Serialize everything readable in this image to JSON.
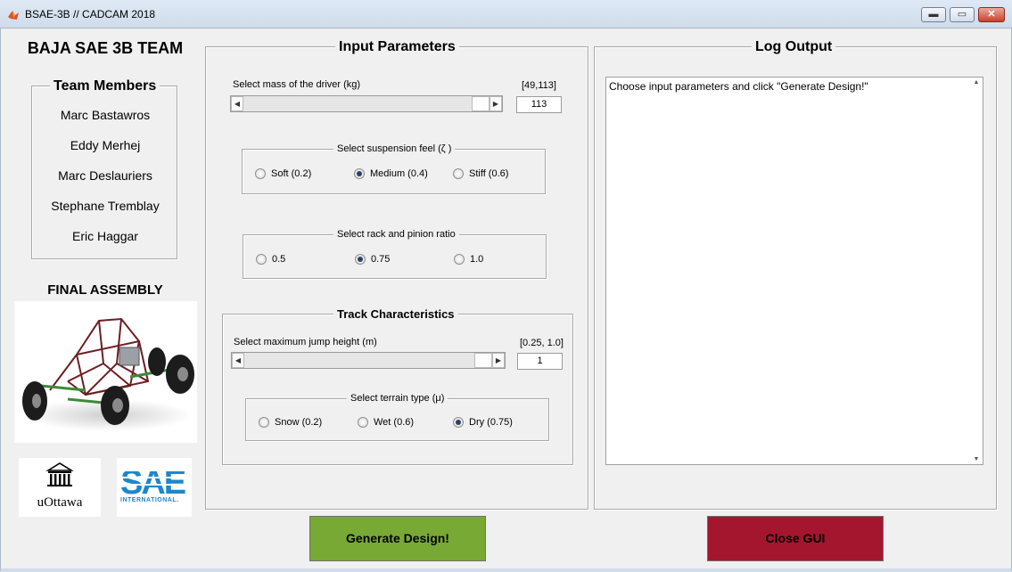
{
  "window": {
    "title": "BSAE-3B // CADCAM 2018",
    "app_icon": "matlab-icon",
    "controls": {
      "minimize": "▬",
      "maximize": "▭",
      "close": "✕"
    }
  },
  "sidebar": {
    "team_title": "BAJA SAE 3B TEAM",
    "members_title": "Team Members",
    "members": [
      "Marc Bastawros",
      "Eddy Merhej",
      "Marc Deslauriers",
      "Stephane Tremblay",
      "Eric Haggar"
    ],
    "assembly_title": "FINAL ASSEMBLY",
    "logos": {
      "uottawa_text": "uOttawa",
      "sae_text": "SAE",
      "sae_subtext": "INTERNATIONAL."
    }
  },
  "input_panel": {
    "title": "Input Parameters",
    "driver_mass": {
      "label": "Select mass of the driver (kg)",
      "range_label": "[49,113]",
      "value": "113",
      "fraction": 1.0
    },
    "suspension": {
      "title": "Select suspension feel (ζ )",
      "options": [
        "Soft (0.2)",
        "Medium (0.4)",
        "Stiff (0.6)"
      ],
      "selected": "Medium (0.4)"
    },
    "rack_pinion": {
      "title": "Select rack and pinion ratio",
      "options": [
        "0.5",
        "0.75",
        "1.0"
      ],
      "selected": "0.75"
    },
    "track": {
      "title": "Track Characteristics",
      "jump": {
        "label": "Select maximum jump height (m)",
        "range_label": "[0.25, 1.0]",
        "value": "1",
        "fraction": 1.0
      },
      "terrain": {
        "title": "Select terrain type (μ)",
        "options": [
          "Snow (0.2)",
          "Wet (0.6)",
          "Dry (0.75)"
        ],
        "selected": "Dry (0.75)"
      }
    }
  },
  "log_panel": {
    "title": "Log Output",
    "text": "Choose input parameters and click \"Generate Design!\""
  },
  "buttons": {
    "generate": "Generate Design!",
    "close": "Close GUI"
  },
  "colors": {
    "generate_bg": "#78a935",
    "close_bg": "#a4162d",
    "sae_blue": "#1e87c9"
  }
}
